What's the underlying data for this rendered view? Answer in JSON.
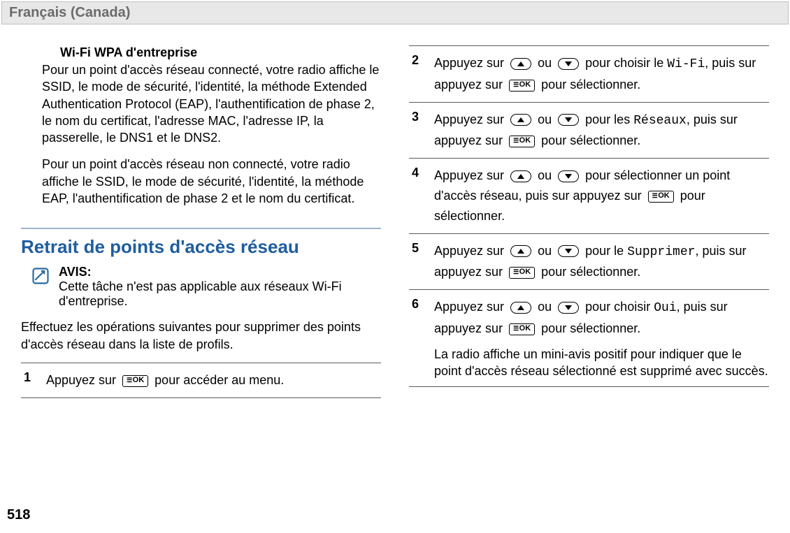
{
  "langHeader": "Français (Canada)",
  "left": {
    "subHeading": "Wi-Fi WPA d'entreprise",
    "para1": "Pour un point d'accès réseau connecté, votre radio affiche le SSID, le mode de sécurité, l'identité, la méthode Extended Authentication Protocol (EAP), l'authentification de phase 2, le nom du certificat, l'adresse MAC, l'adresse IP, la passerelle, le DNS1 et le DNS2.",
    "para2": "Pour un point d'accès réseau non connecté, votre radio affiche le SSID, le mode de sécurité, l'identité, la méthode EAP, l'authentification de phase 2 et le nom du certificat.",
    "sectionTitle": "Retrait de points d'accès réseau",
    "noticeLabel": "AVIS:",
    "noticeText": "Cette tâche n'est pas applicable aux réseaux Wi-Fi d'entreprise.",
    "leadPara": "Effectuez les opérations suivantes pour supprimer des points d'accès réseau dans la liste de profils.",
    "step1": {
      "num": "1",
      "t1": "Appuyez sur",
      "t2": "pour accéder au menu."
    }
  },
  "right": {
    "step2": {
      "num": "2",
      "t1": "Appuyez sur",
      "t2": "ou",
      "t3": "pour choisir le",
      "code": "Wi-Fi",
      "t4": ", puis sur appuyez sur",
      "t5": "pour sélectionner."
    },
    "step3": {
      "num": "3",
      "t1": "Appuyez sur",
      "t2": "ou",
      "t3": "pour les",
      "code": "Réseaux",
      "t4": ", puis sur appuyez sur",
      "t5": "pour sélectionner."
    },
    "step4": {
      "num": "4",
      "t1": "Appuyez sur",
      "t2": "ou",
      "t3": "pour sélectionner un point d'accès réseau, puis sur appuyez sur",
      "t4": "pour sélectionner."
    },
    "step5": {
      "num": "5",
      "t1": "Appuyez sur",
      "t2": "ou",
      "t3": "pour le",
      "code": "Supprimer",
      "t4": ", puis sur appuyez sur",
      "t5": "pour sélectionner."
    },
    "step6": {
      "num": "6",
      "t1": "Appuyez sur",
      "t2": "ou",
      "t3": "pour choisir",
      "code": "Oui",
      "t4": ", puis sur appuyez sur",
      "t5": "pour sélectionner.",
      "result": "La radio affiche un mini-avis positif pour indiquer que le point d'accès réseau sélectionné est supprimé avec succès."
    }
  },
  "pageNumber": "518"
}
